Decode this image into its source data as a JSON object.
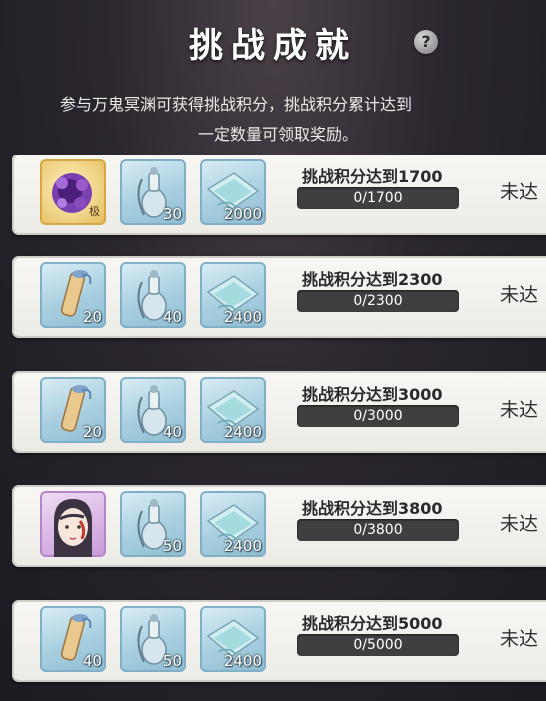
{
  "header": {
    "title": "挑战成就",
    "help_label": "?",
    "desc_line1": "参与万鬼冥渊可获得挑战积分，挑战积分累计达到",
    "desc_line2": "一定数量可领取奖励。"
  },
  "rows": [
    {
      "goal": "挑战积分达到1700",
      "progress_text": "0/1700",
      "progress_fraction": 0,
      "status": "未达",
      "rewards": [
        {
          "icon": "purple-flower-icon",
          "qty": "",
          "tag": "极"
        },
        {
          "icon": "jade-bottle-icon",
          "qty": "30",
          "tag": ""
        },
        {
          "icon": "jade-cloth-icon",
          "qty": "2000",
          "tag": ""
        }
      ]
    },
    {
      "goal": "挑战积分达到2300",
      "progress_text": "0/2300",
      "progress_fraction": 0,
      "status": "未达",
      "rewards": [
        {
          "icon": "scroll-icon",
          "qty": "20",
          "tag": ""
        },
        {
          "icon": "jade-bottle-icon",
          "qty": "40",
          "tag": ""
        },
        {
          "icon": "jade-cloth-icon",
          "qty": "2400",
          "tag": ""
        }
      ]
    },
    {
      "goal": "挑战积分达到3000",
      "progress_text": "0/3000",
      "progress_fraction": 0,
      "status": "未达",
      "rewards": [
        {
          "icon": "scroll-icon",
          "qty": "20",
          "tag": ""
        },
        {
          "icon": "jade-bottle-icon",
          "qty": "40",
          "tag": ""
        },
        {
          "icon": "jade-cloth-icon",
          "qty": "2400",
          "tag": ""
        }
      ]
    },
    {
      "goal": "挑战积分达到3800",
      "progress_text": "0/3800",
      "progress_fraction": 0,
      "status": "未达",
      "rewards": [
        {
          "icon": "character-portrait-icon",
          "qty": "",
          "tag": ""
        },
        {
          "icon": "jade-bottle-icon",
          "qty": "50",
          "tag": ""
        },
        {
          "icon": "jade-cloth-icon",
          "qty": "2400",
          "tag": ""
        }
      ]
    },
    {
      "goal": "挑战积分达到5000",
      "progress_text": "0/5000",
      "progress_fraction": 0,
      "status": "未达",
      "rewards": [
        {
          "icon": "scroll-icon",
          "qty": "40",
          "tag": ""
        },
        {
          "icon": "jade-bottle-icon",
          "qty": "50",
          "tag": ""
        },
        {
          "icon": "jade-cloth-icon",
          "qty": "2400",
          "tag": ""
        }
      ]
    }
  ]
}
